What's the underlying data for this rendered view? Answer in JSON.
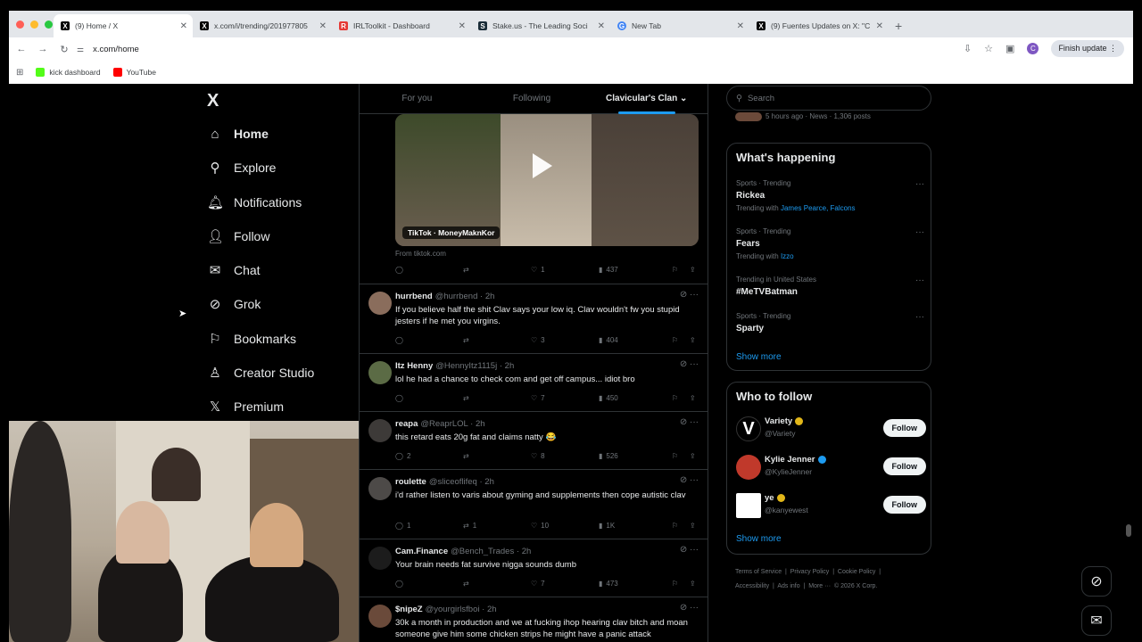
{
  "browser": {
    "tabs": [
      {
        "title": "(9) Home / X",
        "favicon": "X"
      },
      {
        "title": "x.com/i/trending/201977805",
        "favicon": "X"
      },
      {
        "title": "IRLToolkit - Dashboard",
        "favicon": "R"
      },
      {
        "title": "Stake.us - The Leading Soci",
        "favicon": "S"
      },
      {
        "title": "New Tab",
        "favicon": "G"
      },
      {
        "title": "(9) Fuentes Updates on X: \"C",
        "favicon": "X"
      }
    ],
    "url": "x.com/home",
    "finish_update": "Finish update",
    "profile_initial": "C",
    "bookmarks": [
      {
        "label": "kick dashboard",
        "color": "#53fc18"
      },
      {
        "label": "YouTube",
        "color": "#ff0000"
      }
    ]
  },
  "nav": {
    "logo": "X",
    "items": [
      {
        "label": "Home",
        "icon": "home-icon"
      },
      {
        "label": "Explore",
        "icon": "search-icon"
      },
      {
        "label": "Notifications",
        "icon": "bell-icon"
      },
      {
        "label": "Follow",
        "icon": "add-person-icon"
      },
      {
        "label": "Chat",
        "icon": "mail-icon"
      },
      {
        "label": "Grok",
        "icon": "grok-icon"
      },
      {
        "label": "Bookmarks",
        "icon": "bookmark-icon"
      },
      {
        "label": "Creator Studio",
        "icon": "creator-icon"
      },
      {
        "label": "Premium",
        "icon": "x-icon"
      }
    ]
  },
  "feed": {
    "tabs": [
      "For you",
      "Following",
      "Clavicular's Clan"
    ],
    "media_label": "TikTok · MoneyMaknKor",
    "media_from": "From tiktok.com",
    "first_actions": {
      "replies": "",
      "reposts": "",
      "likes": "1",
      "views": "437"
    },
    "posts": [
      {
        "name": "hurrbend",
        "handle": "@hurrbend",
        "time": "2h",
        "text": "If you believe half the shit Clav says your low iq. Clav wouldn't fw you stupid jesters if he met you virgins.",
        "replies": "",
        "reposts": "",
        "likes": "3",
        "views": "404"
      },
      {
        "name": "Itz Henny",
        "handle": "@HennyItz1115j",
        "time": "2h",
        "text": "lol he had a chance to check com and get off campus... idiot bro",
        "replies": "",
        "reposts": "",
        "likes": "7",
        "views": "450"
      },
      {
        "name": "reapa",
        "handle": "@ReaprLOL",
        "time": "2h",
        "text": "this retard eats 20g fat and claims natty 😂",
        "replies": "2",
        "reposts": "",
        "likes": "8",
        "views": "526"
      },
      {
        "name": "roulette",
        "handle": "@sliceoflifeq",
        "time": "2h",
        "text": "i'd rather listen to varis about gyming and supplements then cope autistic clav",
        "replies": "1",
        "reposts": "1",
        "likes": "10",
        "views": "1K"
      },
      {
        "name": "Cam.Finance",
        "handle": "@Bench_Trades",
        "time": "2h",
        "text": "Your brain needs fat survive nigga sounds dumb",
        "replies": "",
        "reposts": "",
        "likes": "7",
        "views": "473"
      },
      {
        "name": "$nipeZ",
        "handle": "@yourgirlsfboi",
        "time": "2h",
        "text": "30k a month in production and we at fucking ihop hearing clav bitch and moan someone give him some chicken strips he might have a panic attack",
        "replies": "",
        "reposts": "",
        "likes": "",
        "views": ""
      }
    ]
  },
  "sidebar": {
    "search_placeholder": "Search",
    "top_partial": "5 hours ago · News · 1,306 posts",
    "whats_happening": "What's happening",
    "trends": [
      {
        "category": "Sports · Trending",
        "name": "Rickea",
        "with_prefix": "Trending with ",
        "with": "James Pearce, Falcons"
      },
      {
        "category": "Sports · Trending",
        "name": "Fears",
        "with_prefix": "Trending with ",
        "with": "Izzo"
      },
      {
        "category": "Trending in United States",
        "name": "#MeTVBatman",
        "with_prefix": "",
        "with": ""
      },
      {
        "category": "Sports · Trending",
        "name": "Sparty",
        "with_prefix": "",
        "with": ""
      }
    ],
    "show_more": "Show more",
    "who_to_follow": "Who to follow",
    "follow_suggestions": [
      {
        "name": "Variety",
        "handle": "@Variety",
        "badge": "#e2b719",
        "button": "Follow"
      },
      {
        "name": "Kylie Jenner",
        "handle": "@KylieJenner",
        "badge": "#1d9bf0",
        "button": "Follow"
      },
      {
        "name": "ye",
        "handle": "@kanyewest",
        "badge": "#e2b719",
        "button": "Follow"
      }
    ],
    "footer": [
      "Terms of Service",
      "Privacy Policy",
      "Cookie Policy",
      "Accessibility",
      "Ads info",
      "More ···",
      "© 2026 X Corp."
    ]
  },
  "colors": {
    "accent": "#1d9bf0",
    "background": "#000000",
    "border": "#2f3336"
  }
}
